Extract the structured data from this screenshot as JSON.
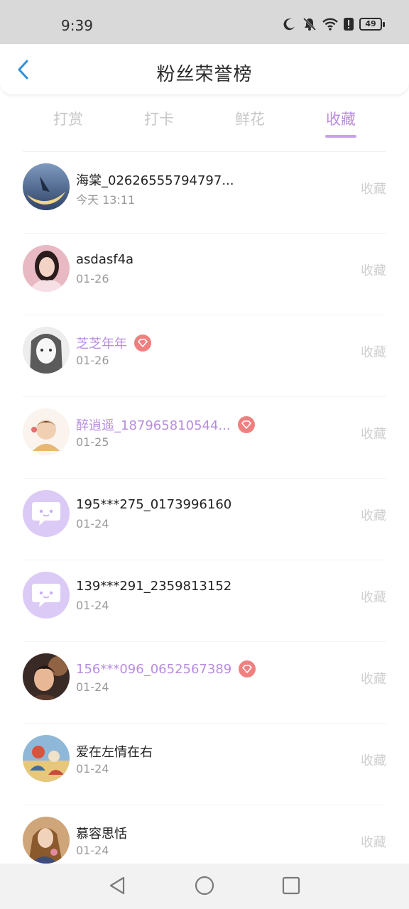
{
  "status_bar": {
    "time": "9:39",
    "battery": "49"
  },
  "header": {
    "title": "粉丝荣誉榜"
  },
  "tabs": [
    {
      "label": "打赏",
      "active": false
    },
    {
      "label": "打卡",
      "active": false
    },
    {
      "label": "鲜花",
      "active": false
    },
    {
      "label": "收藏",
      "active": true
    }
  ],
  "colors": {
    "accent": "#b98ee0",
    "vip_badge": "#f08080",
    "default_avatar": "#dccaf6"
  },
  "rows": [
    {
      "name": "海棠_02626555794797...",
      "date": "今天 13:11",
      "action": "收藏",
      "vip": false,
      "avatar": "photo"
    },
    {
      "name": "asdasf4a",
      "date": "01-26",
      "action": "收藏",
      "vip": false,
      "avatar": "photo"
    },
    {
      "name": "芝芝年年",
      "date": "01-26",
      "action": "收藏",
      "vip": true,
      "avatar": "photo"
    },
    {
      "name": "醉逍遥_187965810544...",
      "date": "01-25",
      "action": "收藏",
      "vip": true,
      "avatar": "photo"
    },
    {
      "name": "195***275_0173996160",
      "date": "01-24",
      "action": "收藏",
      "vip": false,
      "avatar": "default"
    },
    {
      "name": "139***291_2359813152",
      "date": "01-24",
      "action": "收藏",
      "vip": false,
      "avatar": "default"
    },
    {
      "name": "156***096_0652567389",
      "date": "01-24",
      "action": "收藏",
      "vip": true,
      "avatar": "photo"
    },
    {
      "name": "爱在左情在右",
      "date": "01-24",
      "action": "收藏",
      "vip": false,
      "avatar": "photo"
    },
    {
      "name": "慕容思恬",
      "date": "01-24",
      "action": "收藏",
      "vip": false,
      "avatar": "photo"
    }
  ]
}
